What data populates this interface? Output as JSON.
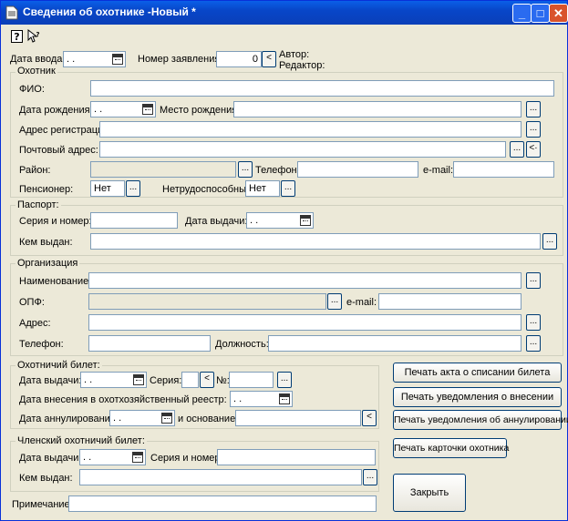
{
  "window": {
    "title": "Сведения об охотнике -Новый *"
  },
  "header": {
    "entry_date_label": "Дата ввода:",
    "entry_date_value": ". .",
    "application_number_label": "Номер заявления:",
    "application_number_value": "0",
    "author_label": "Автор:",
    "editor_label": "Редактор:"
  },
  "hunter": {
    "group_label": "Охотник",
    "fio_label": "ФИО:",
    "birth_date_label": "Дата рождения:",
    "birth_date_value": ". .",
    "birth_place_label": "Место рождения:",
    "reg_address_label": "Адрес регистрации:",
    "postal_address_label": "Почтовый адрес:",
    "district_label": "Район:",
    "phone_label": "Телефон:",
    "email_label": "e-mail:",
    "pensioner_label": "Пенсионер:",
    "pensioner_value": "Нет",
    "disabled_label": "Нетрудоспособный:",
    "disabled_value": "Нет"
  },
  "passport": {
    "group_label": "Паспорт:",
    "series_label": "Серия и номер:",
    "issue_date_label": "Дата выдачи:",
    "issue_date_value": ". .",
    "issued_by_label": "Кем выдан:"
  },
  "organization": {
    "group_label": "Организация",
    "name_label": "Наименование:",
    "opf_label": "ОПФ:",
    "email_label": "e-mail:",
    "address_label": "Адрес:",
    "phone_label": "Телефон:",
    "position_label": "Должность:"
  },
  "hunting_ticket": {
    "group_label": "Охотничий билет:",
    "issue_date_label": "Дата выдачи:",
    "issue_date_value": ". .",
    "series_label": "Серия:",
    "number_label": "№:",
    "registry_date_label": "Дата внесения в охотхозяйственный реестр:",
    "registry_date_value": ". .",
    "cancel_date_label": "Дата аннулирования:",
    "cancel_date_value": ". .",
    "reason_label": "и основание:"
  },
  "member_ticket": {
    "group_label": "Членский охотничий билет:",
    "issue_date_label": "Дата выдачи:",
    "issue_date_value": ". .",
    "series_label": "Серия и номер:",
    "issued_by_label": "Кем выдан:"
  },
  "note_label": "Примечание:",
  "buttons": {
    "print_writeoff": "Печать акта о списании билета",
    "print_entry_notice": "Печать уведомления о внесении",
    "print_cancel_notice": "Печать уведомления об аннулировании",
    "print_card": "Печать карточки охотника",
    "close": "Закрыть"
  }
}
